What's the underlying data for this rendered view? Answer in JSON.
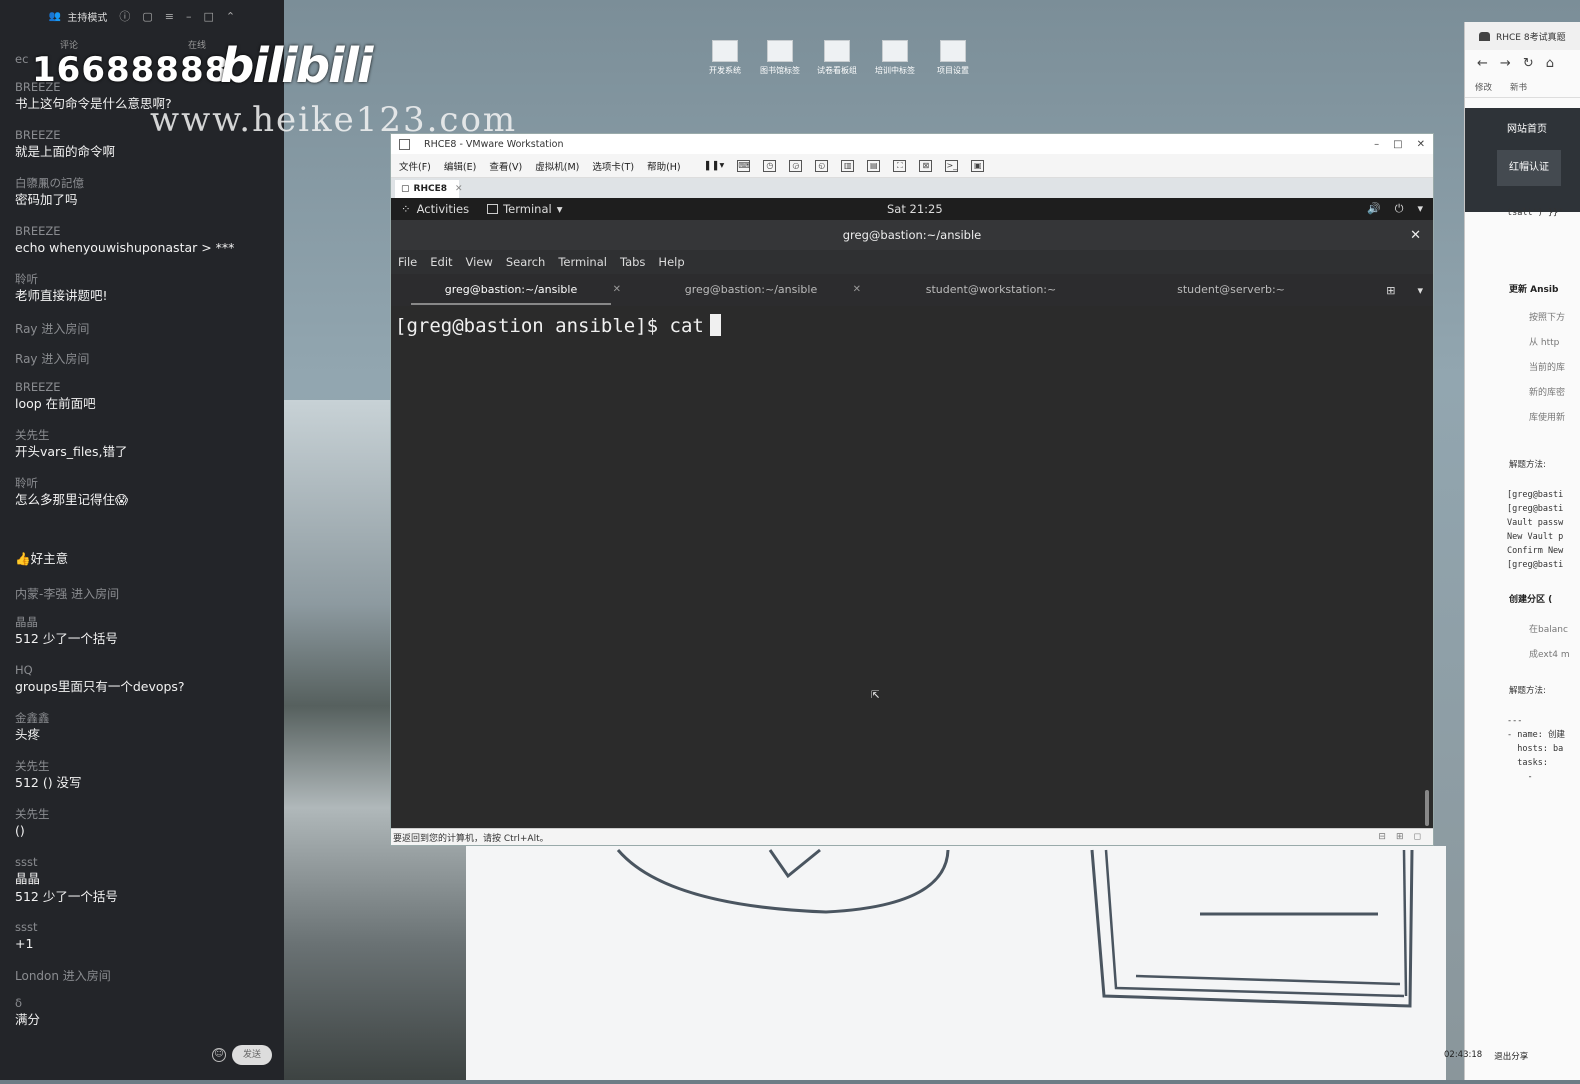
{
  "chat": {
    "mode_label": "主持模式",
    "tabs": [
      "评论",
      "在线"
    ],
    "messages": [
      {
        "user": "ec",
        "text": ""
      },
      {
        "user": "BREEZE",
        "text": "书上这句命令是什么意思啊?"
      },
      {
        "user": "BREEZE",
        "text": "就是上面的命令啊"
      },
      {
        "user": "白隳凲の記億",
        "text": "密码加了吗"
      },
      {
        "user": "BREEZE",
        "text": "echo whenyouwishuponastar > ***"
      },
      {
        "user": "聆听",
        "text": "老师直接讲题吧!"
      },
      {
        "event": "Ray 进入房间"
      },
      {
        "event": "Ray 进入房间"
      },
      {
        "user": "BREEZE",
        "text": "loop 在前面吧"
      },
      {
        "user": "关先生",
        "text": "开头vars_files,错了"
      },
      {
        "user": "聆听",
        "text": "怎么多那里记得住😱"
      },
      {
        "text": "👍好主意"
      },
      {
        "event": "内蒙-李强 进入房间"
      },
      {
        "user": "晶晶",
        "text": "512 少了一个括号"
      },
      {
        "user": "HQ",
        "text": "groups里面只有一个devops?"
      },
      {
        "user": "金鑫鑫",
        "text": "头疼"
      },
      {
        "user": "关先生",
        "text": "512 () 没写"
      },
      {
        "user": "关先生",
        "text": "()"
      },
      {
        "user": "ssst",
        "text": "晶晶\n512 少了一个括号"
      },
      {
        "user": "ssst",
        "text": "+1"
      },
      {
        "event": "London 进入房间"
      },
      {
        "user": "δ",
        "text": "满分"
      }
    ],
    "send_label": "发送"
  },
  "watermark": {
    "number": "16688888",
    "logo": "bilibili",
    "url": "www.heike123.com"
  },
  "desktop_icons": [
    "开发系统",
    "图书馆标签",
    "试卷看板组",
    "培训中标签",
    "项目设置"
  ],
  "vmware": {
    "title": "RHCE8 - VMware Workstation",
    "menu": [
      "文件(F)",
      "编辑(E)",
      "查看(V)",
      "虚拟机(M)",
      "选项卡(T)",
      "帮助(H)"
    ],
    "tab_label": "RHCE8",
    "status_text": "要返回到您的计算机，请按 Ctrl+Alt。"
  },
  "gnome": {
    "activities": "Activities",
    "app_menu": "Terminal",
    "clock": "Sat 21:25"
  },
  "terminal": {
    "title": "greg@bastion:~/ansible",
    "menu": [
      "File",
      "Edit",
      "View",
      "Search",
      "Terminal",
      "Tabs",
      "Help"
    ],
    "tabs": [
      "greg@bastion:~/ansible",
      "greg@bastion:~/ansible",
      "student@workstation:~",
      "student@serverb:~"
    ],
    "prompt": "[greg@bastion ansible]$ cat"
  },
  "browser": {
    "tab_title": "RHCE 8考试真题",
    "bookmarks": [
      "修改",
      "新书"
    ],
    "nav_home": "网站首页",
    "nav_cert": "红帽认证",
    "code_top": "tsalt') }}\"",
    "section1": "更新 Ansib",
    "section1_lines": [
      "按照下方",
      "从 http",
      "当前的库",
      "新的库密",
      "库使用新"
    ],
    "solution_label": "解题方法:",
    "code_block": "[greg@basti\n[greg@basti\nVault passw\nNew Vault p\nConfirm New\n[greg@basti",
    "section2": "创建分区 (",
    "section2_lines": [
      "在balanc",
      "成ext4  m"
    ],
    "solution_label2": "解题方法:",
    "code_block2": "---\n- name: 创建\n  hosts: ba\n  tasks:\n    -",
    "time": "02:43:18",
    "exit_label": "退出分享"
  }
}
